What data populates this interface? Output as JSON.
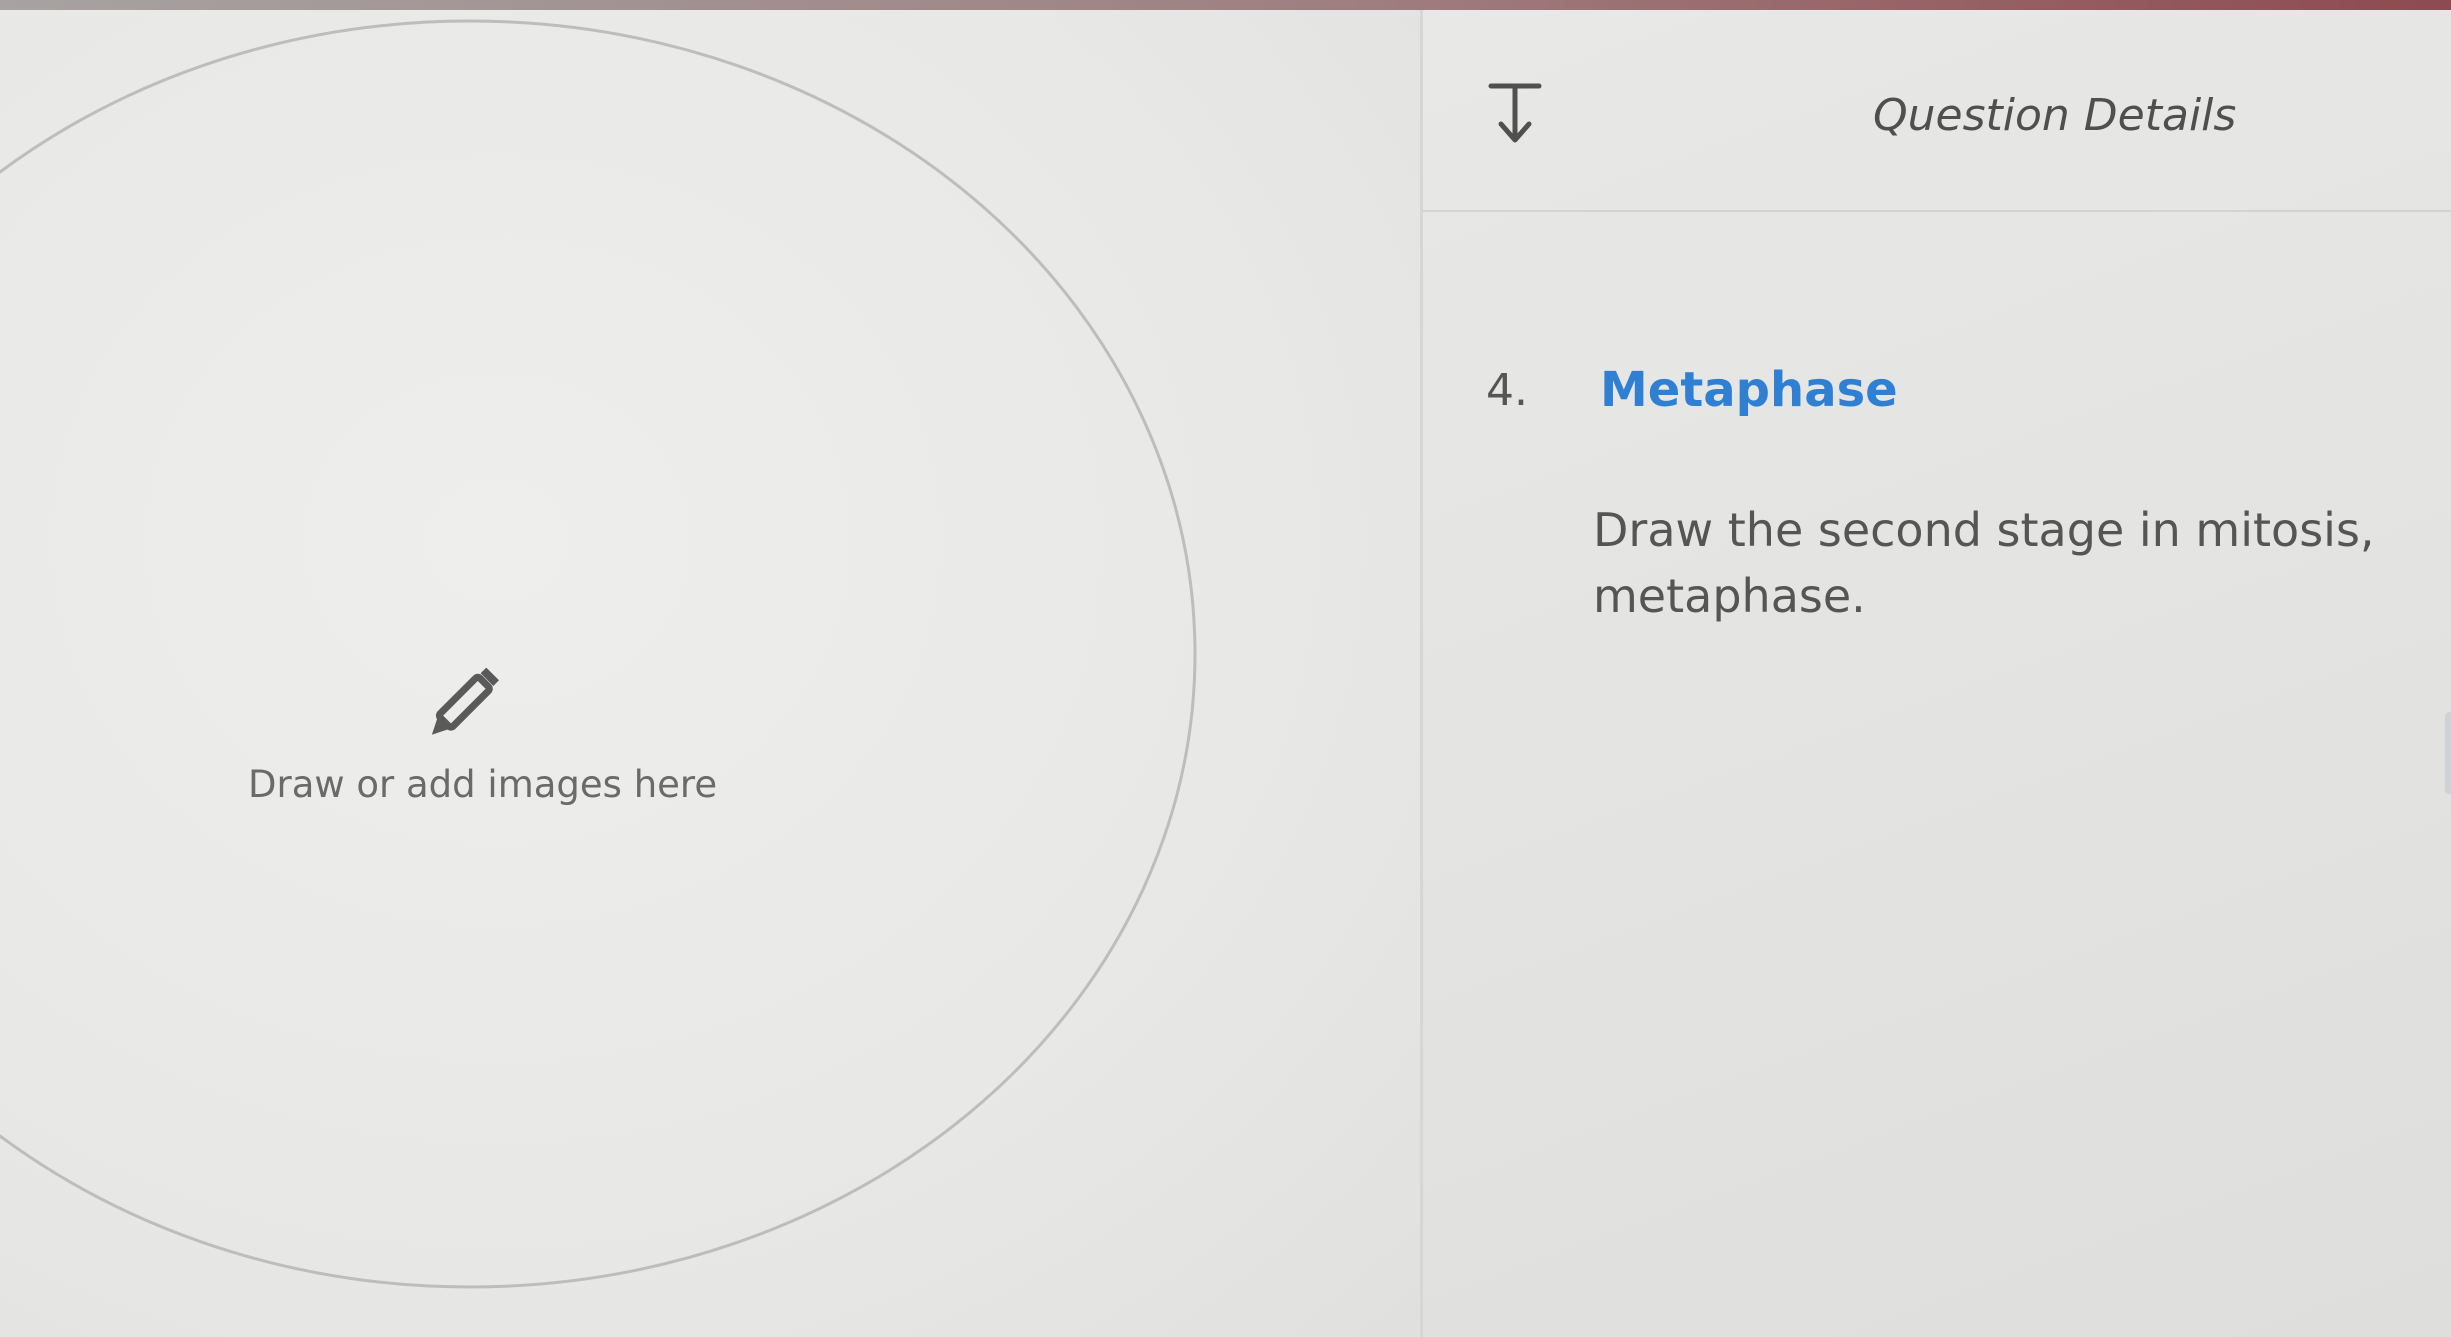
{
  "canvas": {
    "hint": "Draw or add images here",
    "icon": "pencil-icon"
  },
  "details": {
    "header_title": "Question Details",
    "collapse_icon": "collapse-down-icon",
    "question": {
      "number": "4.",
      "title": "Metaphase",
      "body": "Draw the second stage in mitosis, metaphase."
    }
  },
  "colors": {
    "title_blue": "#2f7fd2",
    "text_gray": "#555555",
    "background": "#e6e6e4"
  }
}
